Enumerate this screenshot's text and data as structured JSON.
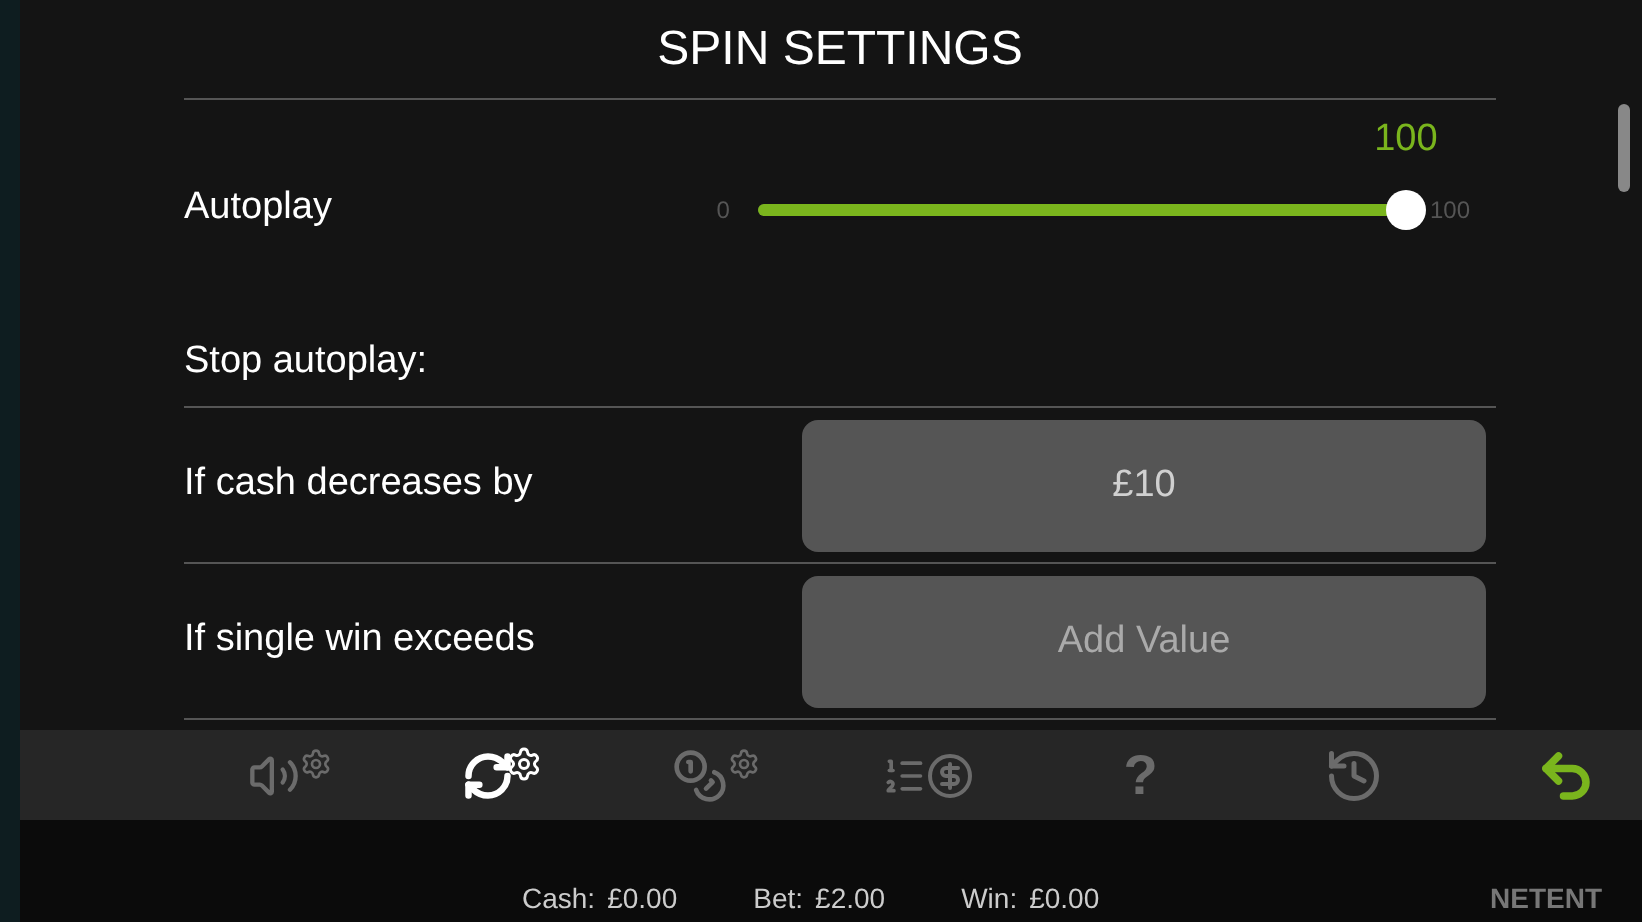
{
  "title": "SPIN SETTINGS",
  "autoplay": {
    "label": "Autoplay",
    "reading": "100",
    "min": "0",
    "max": "100",
    "level": 1
  },
  "stop_autoplay": {
    "heading": "Stop autoplay:",
    "rows": [
      {
        "label": "If cash decreases by",
        "value": "£10"
      },
      {
        "label": "If single win exceeds",
        "placeholder": "Add Value"
      }
    ]
  },
  "toolbar": [
    {
      "kind": "sound",
      "selected": false
    },
    {
      "kind": "autoplay",
      "selected": true
    },
    {
      "kind": "coin",
      "selected": false
    },
    {
      "kind": "paytable",
      "selected": false
    },
    {
      "kind": "help",
      "text": "?",
      "selected": false
    },
    {
      "kind": "history",
      "selected": false
    },
    {
      "kind": "back",
      "selected": false
    }
  ],
  "status_bar": [
    {
      "label": "Cash:",
      "value": "£0.00"
    },
    {
      "label": "Bet:",
      "value": "£2.00"
    },
    {
      "label": "Win:",
      "value": "£0.00"
    }
  ],
  "brand": "NETENT"
}
